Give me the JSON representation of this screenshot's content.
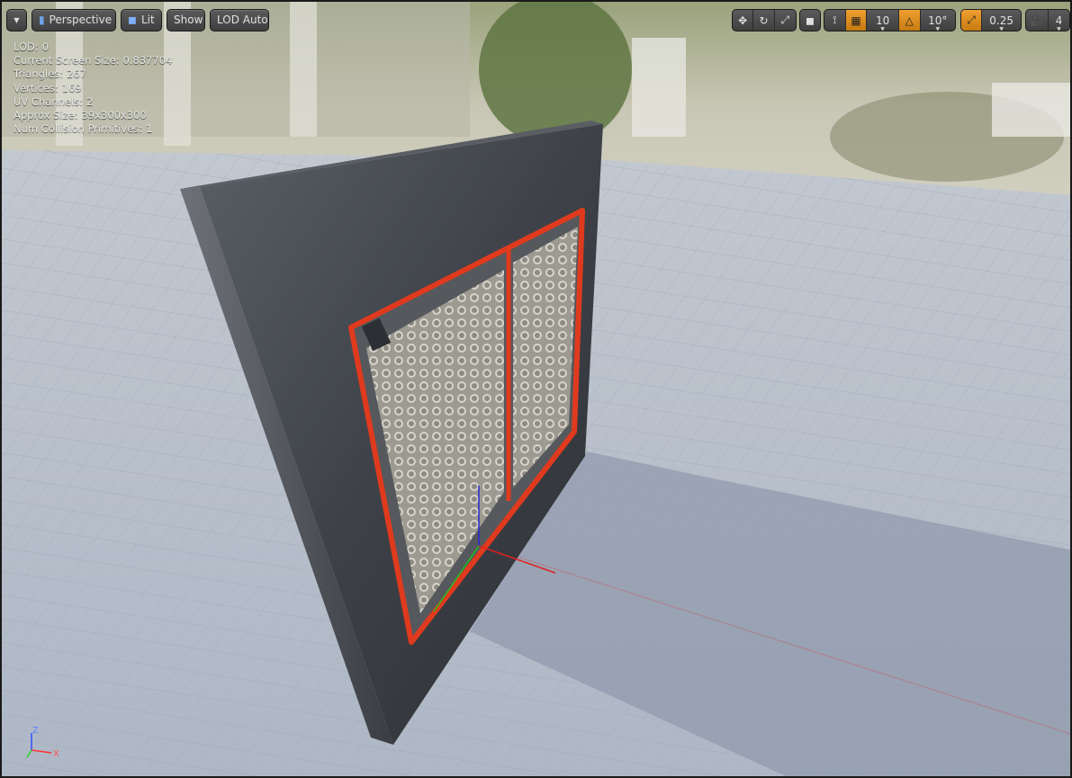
{
  "toolbar": {
    "menu_icon": "chevron-down-icon",
    "perspective_label": "Perspective",
    "lit_label": "Lit",
    "show_label": "Show",
    "lod_label": "LOD Auto",
    "grid_snap_value": "10",
    "rotation_snap_value": "10°",
    "scale_snap_value": "0.25",
    "camera_speed_value": "4"
  },
  "stats": {
    "lod_label": "LOD:",
    "lod_value": "0",
    "screen_size_label": "Current Screen Size:",
    "screen_size_value": "0.837704",
    "triangles_label": "Triangles:",
    "triangles_value": "267",
    "vertices_label": "Vertices:",
    "vertices_value": "169",
    "uv_label": "UV Channels:",
    "uv_value": "2",
    "approx_label": "Approx Size:",
    "approx_value": "39x300x300",
    "collision_label": "Num Collision Primitives:",
    "collision_value": "1"
  },
  "axes": {
    "z": "Z",
    "x": "X"
  },
  "colors": {
    "accent_orange": "#e8961e",
    "panel_red": "#e03a1e",
    "floor": "#b9c0cc"
  }
}
